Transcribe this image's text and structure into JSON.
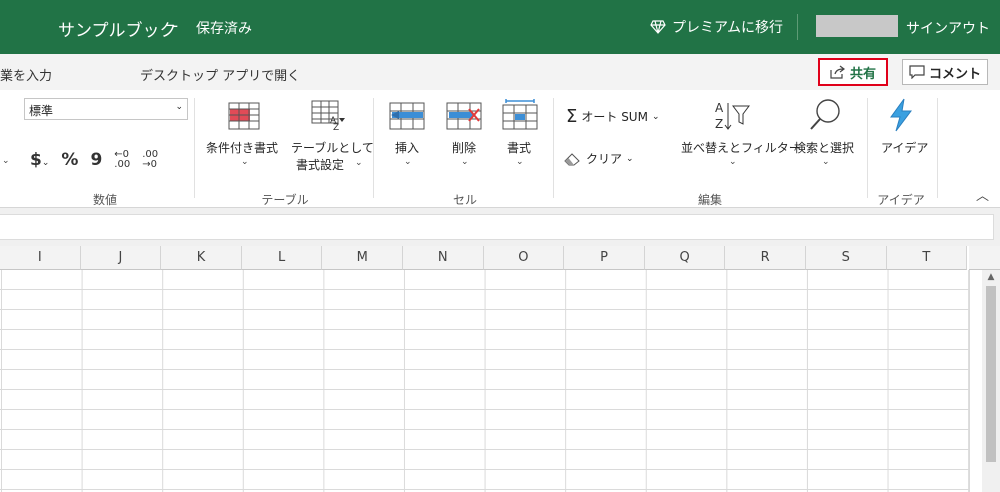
{
  "titlebar": {
    "doc_name": "サンプルブック",
    "separator": "-",
    "save_status": "保存済み",
    "premium_label": "プレミアムに移行",
    "signout_label": "サインアウト"
  },
  "tell_row": {
    "tell_me": "業を入力",
    "open_desktop": "デスクトップ アプリで開く",
    "share_label": "共有",
    "comment_label": "コメント"
  },
  "ribbon": {
    "number": {
      "format_value": "標準",
      "currency": "$",
      "percent": "%",
      "comma": "9",
      "inc_top": "←0",
      "inc_bottom": ".00",
      "dec_top": ".00",
      "dec_bottom": "→0",
      "group_label": "数値"
    },
    "table": {
      "conditional_format": "条件付き書式",
      "format_as_table_1": "テーブルとして",
      "format_as_table_2": "書式設定",
      "group_label": "テーブル"
    },
    "cells": {
      "insert": "挿入",
      "delete": "削除",
      "format": "書式",
      "group_label": "セル"
    },
    "editing": {
      "autosum": "オート SUM",
      "clear": "クリア",
      "sort_filter": "並べ替えとフィルター",
      "find_select": "検索と選択",
      "group_label": "編集"
    },
    "ideas": {
      "ideas": "アイデア",
      "group_label": "アイデア"
    }
  },
  "grid": {
    "columns": [
      "I",
      "J",
      "K",
      "L",
      "M",
      "N",
      "O",
      "P",
      "Q",
      "R",
      "S",
      "T"
    ]
  },
  "colors": {
    "titlebar_bg": "#217346",
    "share_highlight": "#e0001a"
  }
}
